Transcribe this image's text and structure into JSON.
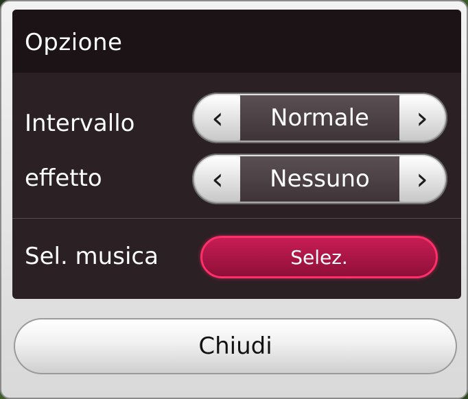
{
  "dialog": {
    "title": "Opzione",
    "rows": [
      {
        "label": "Intervallo",
        "value": "Normale",
        "prev_icon": "chevron-left-icon",
        "next_icon": "chevron-right-icon"
      },
      {
        "label": "effetto",
        "value": "Nessuno",
        "prev_icon": "chevron-left-icon",
        "next_icon": "chevron-right-icon"
      }
    ],
    "music": {
      "label": "Sel. musica",
      "button_label": "Selez."
    },
    "close_label": "Chiudi",
    "colors": {
      "panel": "#2b2024",
      "accent": "#c81d54"
    }
  }
}
